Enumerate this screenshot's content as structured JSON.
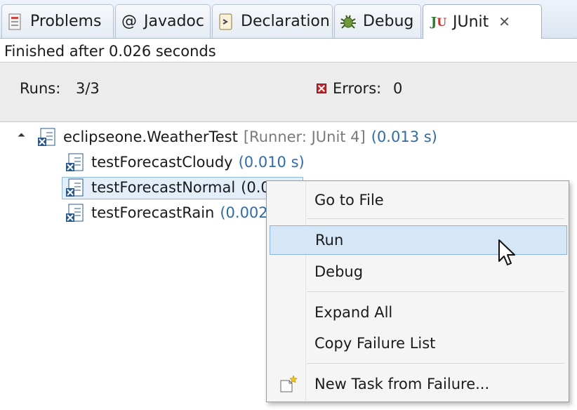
{
  "tabs": [
    {
      "label": "Problems",
      "icon": "problems-icon"
    },
    {
      "label": "Javadoc",
      "icon": "at-icon"
    },
    {
      "label": "Declaration",
      "icon": "declaration-icon"
    },
    {
      "label": "Debug",
      "icon": "bug-icon"
    },
    {
      "label": "JUnit",
      "icon": "junit-icon",
      "active": true
    }
  ],
  "status": "Finished after 0.026 seconds",
  "counters": {
    "runs_label": "Runs:",
    "runs_value": "3/3",
    "errors_label": "Errors:",
    "errors_value": "0"
  },
  "tree": {
    "root": {
      "name": "eclipseone.WeatherTest",
      "runner": "[Runner: JUnit 4]",
      "time": "(0.013 s)"
    },
    "children": [
      {
        "name": "testForecastCloudy",
        "time": "(0.010 s)"
      },
      {
        "name": "testForecastNormal",
        "time": "(0.0"
      },
      {
        "name": "testForecastRain",
        "time": "(0.002"
      }
    ]
  },
  "context_menu": {
    "items": [
      "Go to File",
      "Run",
      "Debug",
      "Expand All",
      "Copy Failure List",
      "New Task from Failure..."
    ],
    "highlighted": "Run"
  },
  "colors": {
    "timing": "#2f6da8",
    "selection": "#e3eef9",
    "menu_highlight": "#d5e6f7",
    "error": "#c2272d"
  }
}
